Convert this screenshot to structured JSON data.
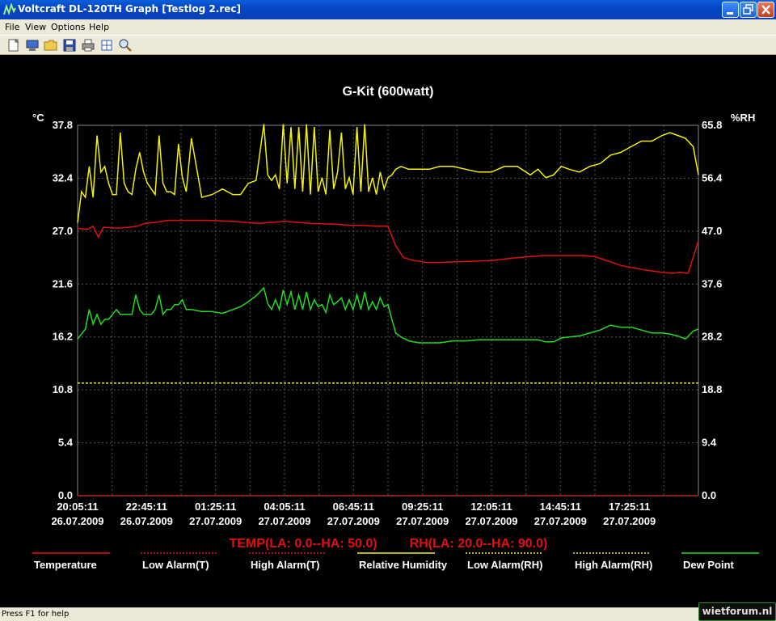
{
  "window": {
    "title": "Voltcraft DL-120TH Graph [Testlog 2.rec]"
  },
  "menu": {
    "file": "File",
    "view": "View",
    "options": "Options",
    "help": "Help"
  },
  "toolbar_icons": [
    "new-icon",
    "monitor-icon",
    "open-folder-icon",
    "save-icon",
    "print-icon",
    "zoom-fit-icon",
    "zoom-icon"
  ],
  "status": {
    "text": "Press F1 for help"
  },
  "watermark": {
    "text": "wietforum.nl"
  },
  "colors": {
    "temperature": "#e01010",
    "humidity": "#f2f200",
    "dew_point": "#20dd20",
    "alarm_rh": "#f2f200",
    "alarm_t": "#e01010"
  },
  "chart_data": {
    "type": "line",
    "title": "G-Kit (600watt)",
    "ylabel_left": "°C",
    "ylabel_right": "%RH",
    "ylim_left": [
      0.0,
      37.8
    ],
    "ylim_right": [
      0.0,
      65.8
    ],
    "yticks_left": [
      "37.8",
      "32.4",
      "27.0",
      "21.6",
      "16.2",
      "10.8",
      "5.4",
      "0.0"
    ],
    "yticks_right": [
      "65.8",
      "56.4",
      "47.0",
      "37.6",
      "28.2",
      "18.8",
      "9.4",
      "0.0"
    ],
    "xticks": [
      {
        "time": "20:05:11",
        "date": "26.07.2009"
      },
      {
        "time": "22:45:11",
        "date": "26.07.2009"
      },
      {
        "time": "01:25:11",
        "date": "27.07.2009"
      },
      {
        "time": "04:05:11",
        "date": "27.07.2009"
      },
      {
        "time": "06:45:11",
        "date": "27.07.2009"
      },
      {
        "time": "09:25:11",
        "date": "27.07.2009"
      },
      {
        "time": "12:05:11",
        "date": "27.07.2009"
      },
      {
        "time": "14:45:11",
        "date": "27.07.2009"
      },
      {
        "time": "17:25:11",
        "date": "27.07.2009"
      }
    ],
    "x_range_hours": [
      0,
      24
    ],
    "alarm_text_temp": "TEMP(LA: 0.0--HA: 50.0)",
    "alarm_text_rh": "RH(LA: 20.0--HA: 90.0)",
    "grid": true,
    "legend": [
      {
        "label": "Temperature",
        "color": "#e01010",
        "style": "solid"
      },
      {
        "label": "Low Alarm(T)",
        "color": "#e01010",
        "style": "dotted"
      },
      {
        "label": "High Alarm(T)",
        "color": "#e01010",
        "style": "dotted"
      },
      {
        "label": "Relative Humidity",
        "color": "#f2f200",
        "style": "solid"
      },
      {
        "label": "Low Alarm(RH)",
        "color": "#f2f200",
        "style": "dotted"
      },
      {
        "label": "High Alarm(RH)",
        "color": "#f2f200",
        "style": "dotted"
      },
      {
        "label": "Dew Point",
        "color": "#20dd20",
        "style": "solid"
      }
    ],
    "series": [
      {
        "name": "Temperature",
        "axis": "left",
        "x": [
          0,
          0.2,
          0.4,
          0.6,
          0.8,
          1.0,
          1.5,
          2.0,
          2.3,
          2.6,
          3.0,
          3.5,
          4.0,
          5.0,
          6.0,
          7.0,
          8.0,
          9.0,
          10.0,
          10.5,
          11.0,
          11.5,
          11.8,
          12.0,
          12.3,
          12.6,
          13.0,
          13.5,
          14.0,
          15.0,
          16.0,
          17.0,
          18.0,
          18.5,
          19.0,
          19.5,
          20.0,
          21.0,
          22.0,
          22.6,
          23.0,
          23.3,
          23.6,
          24.0
        ],
        "values": [
          27.3,
          27.2,
          27.2,
          27.5,
          26.4,
          27.4,
          27.3,
          27.4,
          27.5,
          27.8,
          27.9,
          28.1,
          28.1,
          28.1,
          28.0,
          27.8,
          28.0,
          27.8,
          27.7,
          27.6,
          27.6,
          27.5,
          27.5,
          27.5,
          25.5,
          24.3,
          24.0,
          23.8,
          23.8,
          23.9,
          24.0,
          24.3,
          24.5,
          24.5,
          24.5,
          24.5,
          24.4,
          23.5,
          23.0,
          22.8,
          22.7,
          22.8,
          22.7,
          26.0
        ]
      },
      {
        "name": "Relative Humidity",
        "axis": "right",
        "x": [
          0,
          0.15,
          0.3,
          0.45,
          0.6,
          0.75,
          0.9,
          1.05,
          1.2,
          1.35,
          1.5,
          1.65,
          1.8,
          1.95,
          2.1,
          2.25,
          2.4,
          2.55,
          2.7,
          2.85,
          3.0,
          3.15,
          3.3,
          3.45,
          3.6,
          3.75,
          3.9,
          4.05,
          4.2,
          4.4,
          4.8,
          5.2,
          5.6,
          6.0,
          6.3,
          6.6,
          6.9,
          7.2,
          7.35,
          7.5,
          7.65,
          7.8,
          7.95,
          8.1,
          8.25,
          8.4,
          8.55,
          8.7,
          8.85,
          9.0,
          9.15,
          9.3,
          9.45,
          9.6,
          9.75,
          9.9,
          10.05,
          10.2,
          10.35,
          10.5,
          10.65,
          10.8,
          10.95,
          11.1,
          11.25,
          11.4,
          11.55,
          11.7,
          11.85,
          12.0,
          12.15,
          12.3,
          12.5,
          12.8,
          13.2,
          13.6,
          14.0,
          14.5,
          15.0,
          15.5,
          16.0,
          16.5,
          17.0,
          17.5,
          17.8,
          18.1,
          18.4,
          18.7,
          19.0,
          19.4,
          19.8,
          20.2,
          20.6,
          21.0,
          21.4,
          21.8,
          22.2,
          22.6,
          22.9,
          23.2,
          23.5,
          23.8,
          24.0
        ],
        "values": [
          48.5,
          54.0,
          53.0,
          58.5,
          53.0,
          64.0,
          57.5,
          58.5,
          55.5,
          53.5,
          53.5,
          64.5,
          55.5,
          54.0,
          53.5,
          58.0,
          61.0,
          57.5,
          55.5,
          54.5,
          53.5,
          64.0,
          55.5,
          54.0,
          54.0,
          53.5,
          62.5,
          56.5,
          54.0,
          63.5,
          53.0,
          53.5,
          54.5,
          53.5,
          53.5,
          55.5,
          56.0,
          66.0,
          57.0,
          56.0,
          57.0,
          54.5,
          66.0,
          55.5,
          65.5,
          54.5,
          65.5,
          54.0,
          66.0,
          53.5,
          65.5,
          54.0,
          56.5,
          53.5,
          65.0,
          54.5,
          57.5,
          64.5,
          54.5,
          56.5,
          53.5,
          65.5,
          54.0,
          66.0,
          54.0,
          56.5,
          53.5,
          57.5,
          54.5,
          56.5,
          57.0,
          58.0,
          58.5,
          58.0,
          58.0,
          58.0,
          58.5,
          58.5,
          58.0,
          57.5,
          57.5,
          58.5,
          58.5,
          57.0,
          58.0,
          56.5,
          57.0,
          58.5,
          58.0,
          57.5,
          58.5,
          59.0,
          60.5,
          61.0,
          62.0,
          63.0,
          63.0,
          64.0,
          64.5,
          64.0,
          63.5,
          62.0,
          57.0
        ]
      },
      {
        "name": "Dew Point",
        "axis": "left",
        "x": [
          0,
          0.15,
          0.3,
          0.45,
          0.6,
          0.75,
          0.9,
          1.05,
          1.2,
          1.35,
          1.5,
          1.65,
          1.8,
          1.95,
          2.1,
          2.25,
          2.4,
          2.55,
          2.7,
          2.85,
          3.0,
          3.15,
          3.3,
          3.45,
          3.6,
          3.75,
          3.9,
          4.05,
          4.2,
          4.4,
          4.8,
          5.2,
          5.6,
          6.0,
          6.3,
          6.6,
          6.9,
          7.2,
          7.35,
          7.5,
          7.65,
          7.8,
          7.95,
          8.1,
          8.25,
          8.4,
          8.55,
          8.7,
          8.85,
          9.0,
          9.15,
          9.3,
          9.45,
          9.6,
          9.75,
          9.9,
          10.05,
          10.2,
          10.35,
          10.5,
          10.65,
          10.8,
          10.95,
          11.1,
          11.25,
          11.4,
          11.55,
          11.7,
          11.85,
          12.0,
          12.15,
          12.3,
          12.5,
          12.8,
          13.2,
          13.6,
          14.0,
          14.5,
          15.0,
          15.5,
          16.0,
          16.5,
          17.0,
          17.5,
          17.8,
          18.1,
          18.4,
          18.7,
          19.0,
          19.4,
          19.8,
          20.2,
          20.6,
          21.0,
          21.4,
          21.8,
          22.2,
          22.6,
          22.9,
          23.2,
          23.5,
          23.8,
          24.0
        ],
        "values": [
          16.0,
          16.5,
          17.0,
          19.0,
          17.5,
          18.5,
          17.5,
          18.0,
          18.0,
          18.5,
          19.0,
          18.5,
          18.5,
          18.5,
          18.5,
          20.5,
          19.0,
          18.5,
          18.5,
          18.5,
          19.0,
          20.5,
          18.5,
          19.0,
          19.0,
          19.5,
          19.5,
          20.0,
          19.0,
          19.0,
          18.8,
          18.8,
          18.6,
          19.0,
          19.3,
          19.8,
          20.4,
          21.2,
          19.6,
          19.0,
          20.0,
          19.0,
          21.0,
          19.5,
          20.8,
          19.0,
          20.5,
          19.0,
          20.8,
          19.0,
          20.0,
          19.3,
          19.5,
          18.7,
          20.5,
          19.5,
          19.8,
          20.2,
          19.0,
          20.0,
          19.0,
          20.5,
          19.0,
          20.8,
          19.0,
          19.8,
          19.0,
          20.2,
          19.3,
          19.5,
          18.0,
          16.6,
          16.2,
          15.8,
          15.6,
          15.6,
          15.6,
          15.8,
          15.8,
          15.9,
          15.9,
          15.9,
          15.9,
          15.9,
          15.9,
          15.7,
          15.7,
          16.1,
          16.2,
          16.3,
          16.6,
          16.9,
          17.4,
          17.2,
          17.2,
          16.9,
          16.6,
          16.6,
          16.5,
          16.3,
          16.0,
          16.8,
          17.0
        ]
      }
    ],
    "alarm_lines": [
      {
        "name": "High Alarm(T)",
        "axis": "left",
        "value": 50.0
      },
      {
        "name": "Low Alarm(T)",
        "axis": "left",
        "value": 0.0
      },
      {
        "name": "High Alarm(RH)",
        "axis": "right",
        "value": 90.0
      },
      {
        "name": "Low Alarm(RH)",
        "axis": "right",
        "value": 20.0
      }
    ]
  }
}
